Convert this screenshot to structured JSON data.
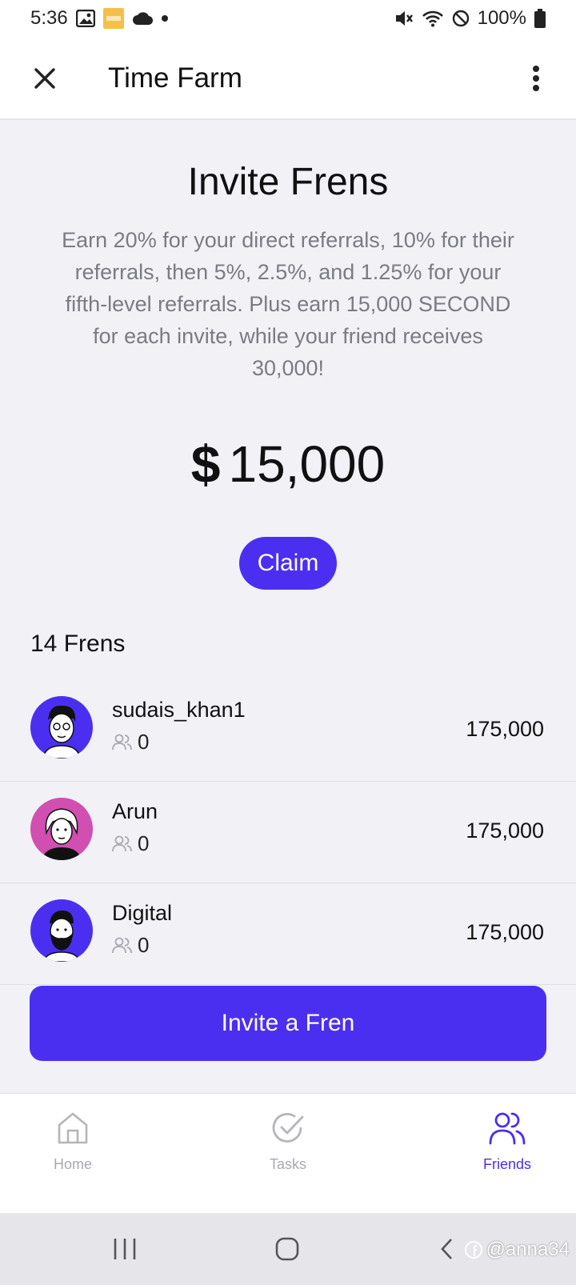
{
  "status_bar": {
    "time": "5:36",
    "battery": "100%"
  },
  "app_bar": {
    "title": "Time Farm"
  },
  "hero": {
    "title": "Invite Frens",
    "description": "Earn 20% for your direct referrals, 10% for their referrals, then 5%, 2.5%, and 1.25% for your fifth-level referrals. Plus earn 15,000 SECOND for each invite, while your friend receives 30,000!",
    "currency_symbol": "$",
    "amount": "15,000",
    "claim_label": "Claim"
  },
  "frens": {
    "count_label": "14 Frens",
    "items": [
      {
        "name": "sudais_khan1",
        "sub_count": "0",
        "value": "175,000",
        "avatar_bg": "#4b2ff0"
      },
      {
        "name": "Arun",
        "sub_count": "0",
        "value": "175,000",
        "avatar_bg": "#d04fb0"
      },
      {
        "name": "Digital",
        "sub_count": "0",
        "value": "175,000",
        "avatar_bg": "#4b2ff0"
      }
    ]
  },
  "invite_button_label": "Invite a Fren",
  "bottom_nav": [
    {
      "label": "Home",
      "icon": "home-icon",
      "active": false
    },
    {
      "label": "Tasks",
      "icon": "check-circle-icon",
      "active": false
    },
    {
      "label": "Friends",
      "icon": "friends-icon",
      "active": true
    }
  ],
  "watermark": "@anna34",
  "colors": {
    "accent": "#4b2ff0",
    "muted_text": "#7b7b85",
    "background": "#f1f1f6"
  }
}
